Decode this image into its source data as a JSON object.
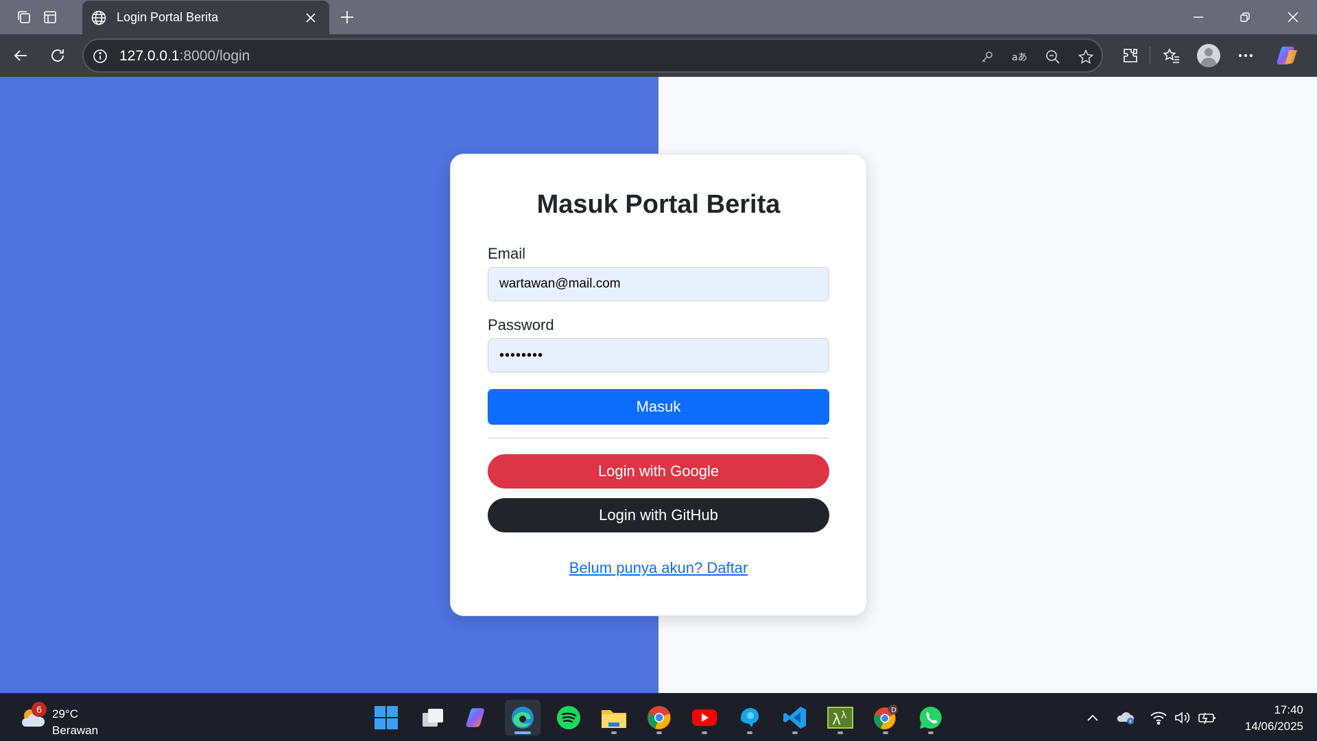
{
  "browser": {
    "tab_title": "Login Portal Berita",
    "url_host": "127.0.0.1",
    "url_rest": ":8000/login"
  },
  "page": {
    "left_color": "#4e73df",
    "right_color": "#f8f9fc"
  },
  "login_card": {
    "title": "Masuk Portal Berita",
    "email_label": "Email",
    "email_value": "wartawan@mail.com",
    "password_label": "Password",
    "password_value": "••••••••",
    "submit_label": "Masuk",
    "google_label": "Login with Google",
    "github_label": "Login with GitHub",
    "register_link": "Belum punya akun? Daftar"
  },
  "taskbar": {
    "weather_temp": "29°C",
    "weather_desc": "Berawan",
    "weather_badge": "6",
    "time": "17:40",
    "date": "14/06/2025",
    "apps": [
      "start-icon",
      "task-view-icon",
      "copilot-icon",
      "edge-icon",
      "spotify-icon",
      "file-explorer-icon",
      "chrome-icon",
      "youtube-icon",
      "app-icon",
      "vscode-icon",
      "terminal-icon",
      "chrome-profile-icon",
      "whatsapp-icon"
    ]
  },
  "colors": {
    "primary": "#0d6efd",
    "google": "#dc3545",
    "github": "#212529"
  }
}
